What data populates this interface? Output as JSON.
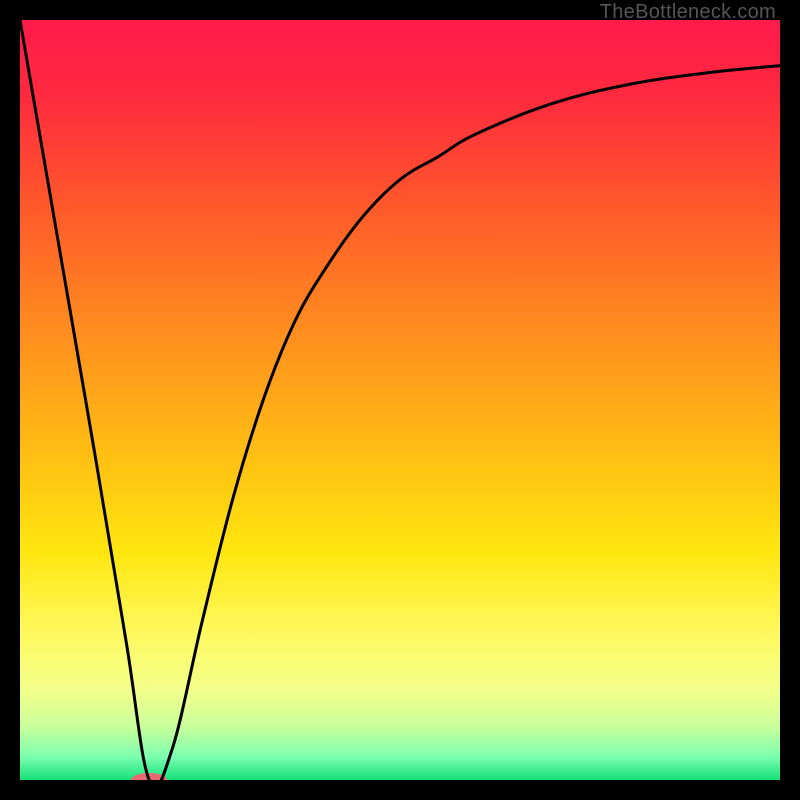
{
  "watermark": "TheBottleneck.com",
  "chart_data": {
    "type": "line",
    "title": "",
    "xlabel": "",
    "ylabel": "",
    "xlim": [
      0,
      100
    ],
    "ylim": [
      0,
      100
    ],
    "grid": false,
    "series": [
      {
        "name": "bottleneck-curve",
        "x": [
          0,
          5,
          10,
          14,
          17,
          20,
          24,
          28,
          32,
          36,
          40,
          45,
          50,
          55,
          60,
          70,
          80,
          90,
          100
        ],
        "values": [
          100,
          71,
          42,
          18,
          0,
          4,
          21,
          37,
          50,
          60,
          67,
          74,
          79,
          82,
          85,
          89,
          91.5,
          93,
          94
        ]
      }
    ],
    "background_gradient_stops": [
      {
        "offset": 0.0,
        "color": "#ff1a4b"
      },
      {
        "offset": 0.1,
        "color": "#ff2a3f"
      },
      {
        "offset": 0.25,
        "color": "#ff5a2a"
      },
      {
        "offset": 0.4,
        "color": "#ff8a1f"
      },
      {
        "offset": 0.55,
        "color": "#ffb814"
      },
      {
        "offset": 0.7,
        "color": "#ffe60f"
      },
      {
        "offset": 0.8,
        "color": "#fff85a"
      },
      {
        "offset": 0.88,
        "color": "#f4ff8a"
      },
      {
        "offset": 0.93,
        "color": "#c8ff9a"
      },
      {
        "offset": 0.97,
        "color": "#7affaf"
      },
      {
        "offset": 1.0,
        "color": "#16e07a"
      }
    ],
    "marker": {
      "name": "bottleneck-point",
      "x": 17,
      "y": 0,
      "rx": 18,
      "ry": 7,
      "color": "#e96a6f"
    }
  }
}
